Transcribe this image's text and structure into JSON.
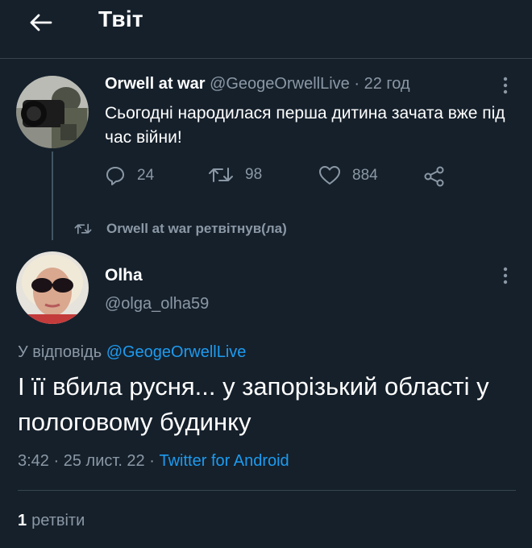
{
  "header": {
    "title": "Твіт"
  },
  "parent_tweet": {
    "name": "Orwell at war",
    "handle": "@GeogeOrwellLive",
    "separator": "·",
    "time": "22 год",
    "text": "Сьогодні народилася перша дитина зачата вже під час війни!",
    "actions": {
      "replies": "24",
      "retweets": "98",
      "likes": "884"
    }
  },
  "retweet_note": "Orwell at war ретвітнув(ла)",
  "main_tweet": {
    "name": "Olha",
    "handle": "@olga_olha59",
    "reply_prefix": "У відповідь",
    "reply_handle": "@GeogeOrwellLive",
    "text": "І її вбила русня... у запорізький області у пологовому будинку",
    "time": "3:42",
    "date": "25 лист. 22",
    "separator": "·",
    "source": "Twitter for Android"
  },
  "stats": {
    "retweets_count": "1",
    "retweets_label": "ретвіти"
  },
  "icons": [
    "arrow-left-icon",
    "more-vertical-icon",
    "reply-icon",
    "retweet-icon",
    "heart-icon",
    "share-icon"
  ],
  "colors": {
    "background": "#15202b",
    "text": "#ffffff",
    "muted": "#8b98a5",
    "link": "#1d9bf0",
    "divider": "#38444d"
  }
}
